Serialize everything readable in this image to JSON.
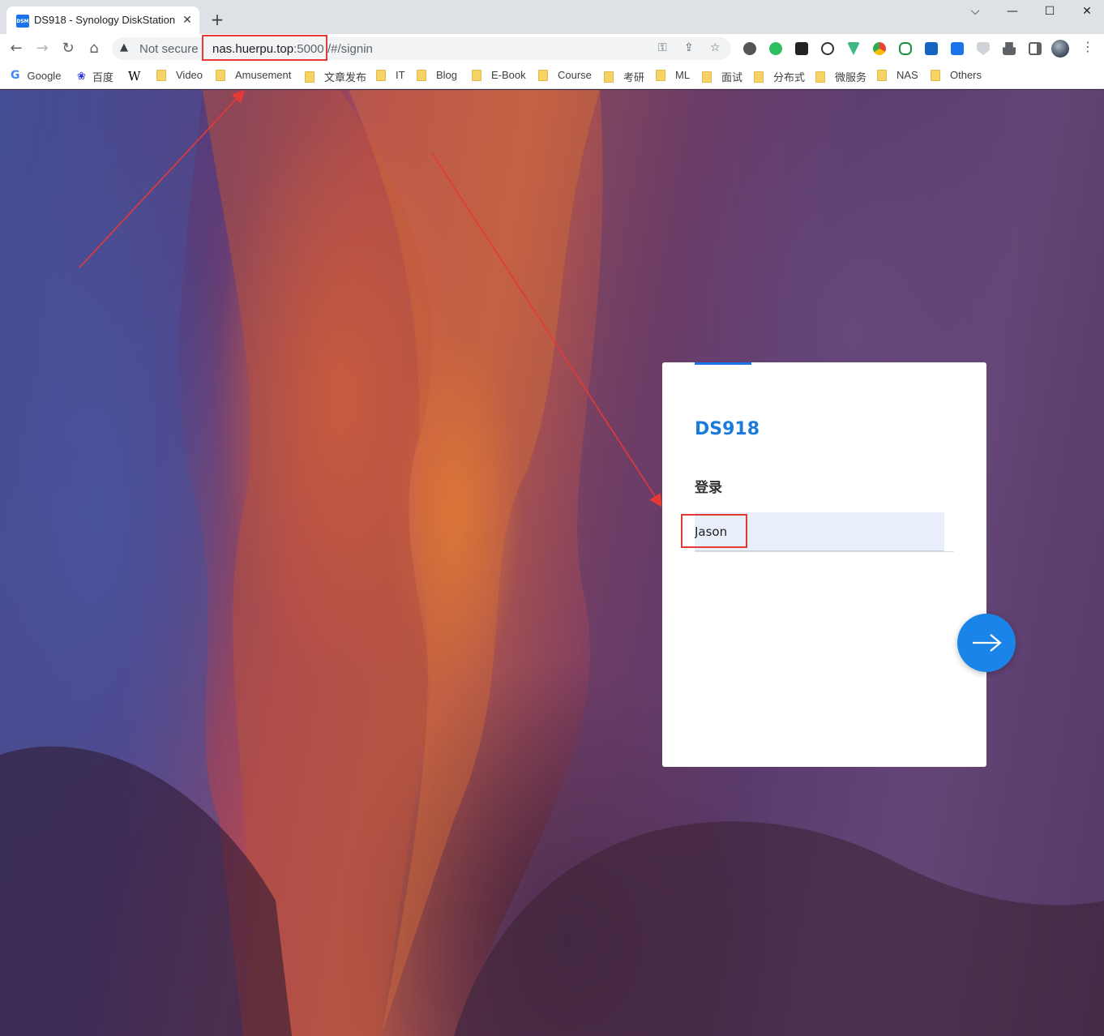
{
  "browser": {
    "tab": {
      "favicon_text": "DSM",
      "title": "DS918 - Synology DiskStation",
      "close": "✕"
    },
    "new_tab": "+",
    "window_controls": {
      "minimize": "⌵",
      "restore": "—",
      "maximize": "☐",
      "close": "✕"
    },
    "toolbar": {
      "security_label": "Not secure",
      "url_host": "nas.huerpu.top",
      "url_port": ":5000",
      "url_path": "/#/signin"
    },
    "bookmarks": [
      {
        "label": "Google",
        "icon": "google-icon"
      },
      {
        "label": "百度",
        "icon": "baidu-icon"
      },
      {
        "label": "",
        "icon": "wikipedia-icon",
        "glyph": "W"
      },
      {
        "label": "Video",
        "icon": "folder-icon"
      },
      {
        "label": "Amusement",
        "icon": "folder-icon"
      },
      {
        "label": "文章发布",
        "icon": "folder-icon"
      },
      {
        "label": "IT",
        "icon": "folder-icon"
      },
      {
        "label": "Blog",
        "icon": "folder-icon"
      },
      {
        "label": "E-Book",
        "icon": "folder-icon"
      },
      {
        "label": "Course",
        "icon": "folder-icon"
      },
      {
        "label": "考研",
        "icon": "folder-icon"
      },
      {
        "label": "ML",
        "icon": "folder-icon"
      },
      {
        "label": "面试",
        "icon": "folder-icon"
      },
      {
        "label": "分布式",
        "icon": "folder-icon"
      },
      {
        "label": "微服务",
        "icon": "folder-icon"
      },
      {
        "label": "NAS",
        "icon": "folder-icon"
      },
      {
        "label": "Others",
        "icon": "folder-icon"
      }
    ]
  },
  "login": {
    "device_name": "DS918",
    "heading": "登录",
    "username_value": "Jason",
    "next_label": "→"
  },
  "colors": {
    "accent": "#1a7bdc",
    "annotation": "#e53935"
  }
}
